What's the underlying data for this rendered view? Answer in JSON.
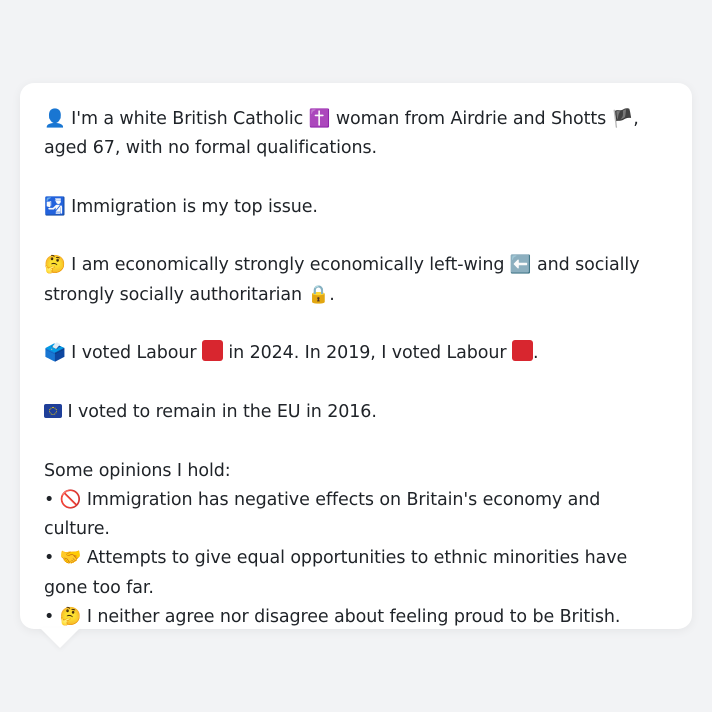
{
  "profile": {
    "identity": {
      "icon": "👤",
      "text_a": " I'm a white British Catholic ",
      "icon2": "✝️",
      "text_b": " woman from Airdrie and Shotts ",
      "icon3": "🏴",
      "text_c": ", aged 67, with no formal qualifications."
    },
    "top_issue": {
      "icon": "🛂",
      "text": " Immigration is my top issue."
    },
    "ideology": {
      "icon": "🤔",
      "text_a": " I am economically strongly economically left-wing ",
      "icon2": "⬅️",
      "text_b": " and socially strongly socially authoritarian ",
      "icon3": "🔒",
      "text_c": "."
    },
    "vote": {
      "icon": "🗳️",
      "text_a": " I voted Labour ",
      "text_b": " in 2024. In 2019, I voted Labour ",
      "text_c": ".",
      "party_color": "#d8262f"
    },
    "eu": {
      "icon": "eu-flag",
      "text": " I voted to remain in the EU in 2016."
    },
    "opinions": {
      "heading": "Some opinions I hold:",
      "items": [
        {
          "bullet": "•",
          "icon": "🚫",
          "text": " Immigration has negative effects on Britain's economy and culture."
        },
        {
          "bullet": "•",
          "icon": "🤝",
          "text": " Attempts to give equal opportunities to ethnic minorities have gone too far."
        },
        {
          "bullet": "•",
          "icon": "🤔",
          "text": " I neither agree nor disagree about feeling proud to be British."
        }
      ]
    }
  }
}
